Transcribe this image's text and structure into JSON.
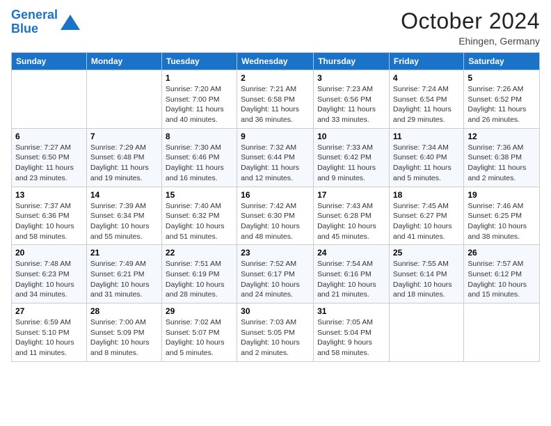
{
  "header": {
    "logo_line1": "General",
    "logo_line2": "Blue",
    "month": "October 2024",
    "location": "Ehingen, Germany"
  },
  "days_of_week": [
    "Sunday",
    "Monday",
    "Tuesday",
    "Wednesday",
    "Thursday",
    "Friday",
    "Saturday"
  ],
  "weeks": [
    [
      {
        "day": "",
        "info": ""
      },
      {
        "day": "",
        "info": ""
      },
      {
        "day": "1",
        "info": "Sunrise: 7:20 AM\nSunset: 7:00 PM\nDaylight: 11 hours and 40 minutes."
      },
      {
        "day": "2",
        "info": "Sunrise: 7:21 AM\nSunset: 6:58 PM\nDaylight: 11 hours and 36 minutes."
      },
      {
        "day": "3",
        "info": "Sunrise: 7:23 AM\nSunset: 6:56 PM\nDaylight: 11 hours and 33 minutes."
      },
      {
        "day": "4",
        "info": "Sunrise: 7:24 AM\nSunset: 6:54 PM\nDaylight: 11 hours and 29 minutes."
      },
      {
        "day": "5",
        "info": "Sunrise: 7:26 AM\nSunset: 6:52 PM\nDaylight: 11 hours and 26 minutes."
      }
    ],
    [
      {
        "day": "6",
        "info": "Sunrise: 7:27 AM\nSunset: 6:50 PM\nDaylight: 11 hours and 23 minutes."
      },
      {
        "day": "7",
        "info": "Sunrise: 7:29 AM\nSunset: 6:48 PM\nDaylight: 11 hours and 19 minutes."
      },
      {
        "day": "8",
        "info": "Sunrise: 7:30 AM\nSunset: 6:46 PM\nDaylight: 11 hours and 16 minutes."
      },
      {
        "day": "9",
        "info": "Sunrise: 7:32 AM\nSunset: 6:44 PM\nDaylight: 11 hours and 12 minutes."
      },
      {
        "day": "10",
        "info": "Sunrise: 7:33 AM\nSunset: 6:42 PM\nDaylight: 11 hours and 9 minutes."
      },
      {
        "day": "11",
        "info": "Sunrise: 7:34 AM\nSunset: 6:40 PM\nDaylight: 11 hours and 5 minutes."
      },
      {
        "day": "12",
        "info": "Sunrise: 7:36 AM\nSunset: 6:38 PM\nDaylight: 11 hours and 2 minutes."
      }
    ],
    [
      {
        "day": "13",
        "info": "Sunrise: 7:37 AM\nSunset: 6:36 PM\nDaylight: 10 hours and 58 minutes."
      },
      {
        "day": "14",
        "info": "Sunrise: 7:39 AM\nSunset: 6:34 PM\nDaylight: 10 hours and 55 minutes."
      },
      {
        "day": "15",
        "info": "Sunrise: 7:40 AM\nSunset: 6:32 PM\nDaylight: 10 hours and 51 minutes."
      },
      {
        "day": "16",
        "info": "Sunrise: 7:42 AM\nSunset: 6:30 PM\nDaylight: 10 hours and 48 minutes."
      },
      {
        "day": "17",
        "info": "Sunrise: 7:43 AM\nSunset: 6:28 PM\nDaylight: 10 hours and 45 minutes."
      },
      {
        "day": "18",
        "info": "Sunrise: 7:45 AM\nSunset: 6:27 PM\nDaylight: 10 hours and 41 minutes."
      },
      {
        "day": "19",
        "info": "Sunrise: 7:46 AM\nSunset: 6:25 PM\nDaylight: 10 hours and 38 minutes."
      }
    ],
    [
      {
        "day": "20",
        "info": "Sunrise: 7:48 AM\nSunset: 6:23 PM\nDaylight: 10 hours and 34 minutes."
      },
      {
        "day": "21",
        "info": "Sunrise: 7:49 AM\nSunset: 6:21 PM\nDaylight: 10 hours and 31 minutes."
      },
      {
        "day": "22",
        "info": "Sunrise: 7:51 AM\nSunset: 6:19 PM\nDaylight: 10 hours and 28 minutes."
      },
      {
        "day": "23",
        "info": "Sunrise: 7:52 AM\nSunset: 6:17 PM\nDaylight: 10 hours and 24 minutes."
      },
      {
        "day": "24",
        "info": "Sunrise: 7:54 AM\nSunset: 6:16 PM\nDaylight: 10 hours and 21 minutes."
      },
      {
        "day": "25",
        "info": "Sunrise: 7:55 AM\nSunset: 6:14 PM\nDaylight: 10 hours and 18 minutes."
      },
      {
        "day": "26",
        "info": "Sunrise: 7:57 AM\nSunset: 6:12 PM\nDaylight: 10 hours and 15 minutes."
      }
    ],
    [
      {
        "day": "27",
        "info": "Sunrise: 6:59 AM\nSunset: 5:10 PM\nDaylight: 10 hours and 11 minutes."
      },
      {
        "day": "28",
        "info": "Sunrise: 7:00 AM\nSunset: 5:09 PM\nDaylight: 10 hours and 8 minutes."
      },
      {
        "day": "29",
        "info": "Sunrise: 7:02 AM\nSunset: 5:07 PM\nDaylight: 10 hours and 5 minutes."
      },
      {
        "day": "30",
        "info": "Sunrise: 7:03 AM\nSunset: 5:05 PM\nDaylight: 10 hours and 2 minutes."
      },
      {
        "day": "31",
        "info": "Sunrise: 7:05 AM\nSunset: 5:04 PM\nDaylight: 9 hours and 58 minutes."
      },
      {
        "day": "",
        "info": ""
      },
      {
        "day": "",
        "info": ""
      }
    ]
  ]
}
